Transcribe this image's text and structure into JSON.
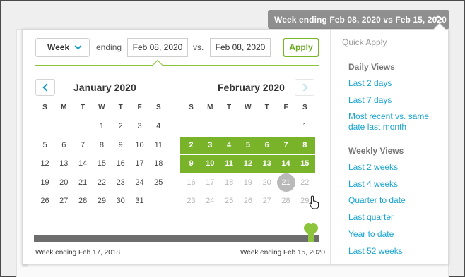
{
  "trigger": {
    "label": "Week ending Feb 08, 2020 vs Feb 15, 2020"
  },
  "controls": {
    "period": "Week",
    "ending_label": "ending",
    "ending_value": "Feb 08, 2020",
    "vs_label": "vs.",
    "vs_value": "Feb 08, 2020",
    "apply_label": "Apply"
  },
  "calendar": {
    "weekdays": [
      "S",
      "M",
      "T",
      "W",
      "T",
      "F",
      "S"
    ],
    "left": {
      "title": "January 2020",
      "weeks": [
        [
          "",
          "",
          "",
          "1",
          "2",
          "3",
          "4"
        ],
        [
          "5",
          "6",
          "7",
          "8",
          "9",
          "10",
          "11"
        ],
        [
          "12",
          "13",
          "14",
          "15",
          "16",
          "17",
          "18"
        ],
        [
          "19",
          "20",
          "21",
          "22",
          "23",
          "24",
          "25"
        ],
        [
          "26",
          "27",
          "28",
          "29",
          "30",
          "31",
          ""
        ]
      ]
    },
    "right": {
      "title": "February 2020",
      "weeks": [
        [
          "",
          "",
          "",
          "",
          "",
          "",
          "1"
        ],
        [
          "2",
          "3",
          "4",
          "5",
          "6",
          "7",
          "8"
        ],
        [
          "9",
          "10",
          "11",
          "12",
          "13",
          "14",
          "15"
        ],
        [
          "16",
          "17",
          "18",
          "19",
          "20",
          "21",
          "22"
        ],
        [
          "23",
          "24",
          "25",
          "26",
          "27",
          "28",
          "29"
        ]
      ],
      "selected_weeks": [
        1,
        2
      ],
      "muted_from_week": 3,
      "today": "21"
    }
  },
  "timeline": {
    "start_label": "Week ending Feb 17, 2018",
    "end_label": "Week ending Feb 15, 2020",
    "position": 0.97
  },
  "quick_apply": {
    "heading": "Quick Apply",
    "daily_heading": "Daily Views",
    "daily": [
      "Last 2 days",
      "Last 7 days",
      "Most recent vs. same date last month"
    ],
    "weekly_heading": "Weekly Views",
    "weekly": [
      "Last 2 weeks",
      "Last 4 weeks",
      "Quarter to date",
      "Last quarter",
      "Year to date",
      "Last 52 weeks"
    ]
  },
  "colors": {
    "accent": "#1aa5d0",
    "selection": "#78b32a",
    "trigger_bg": "#8f8f8f"
  }
}
